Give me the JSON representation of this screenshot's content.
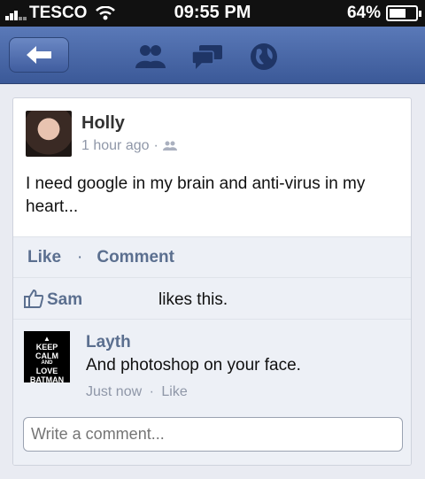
{
  "status_bar": {
    "carrier": "TESCO",
    "time": "09:55 PM",
    "battery": "64%",
    "battery_level": 0.64
  },
  "nav": {
    "back_icon": "back-arrow-icon",
    "icons": [
      "friends-icon",
      "messages-icon",
      "globe-icon"
    ]
  },
  "post": {
    "author": "Holly",
    "time": "1 hour ago",
    "separator": "·",
    "text": "I need google in my brain and anti-virus in my heart...",
    "actions": {
      "like": "Like",
      "separator": "·",
      "comment": "Comment"
    },
    "likes": {
      "name": "Sam",
      "text": "likes this."
    },
    "comment": {
      "avatar_text": [
        "KEEP",
        "CALM",
        "AND",
        "LOVE",
        "BATMAN"
      ],
      "author": "Layth",
      "text": "And photoshop on your face.",
      "time": "Just now",
      "separator": "·",
      "like": "Like"
    },
    "input": {
      "placeholder": "Write a comment..."
    }
  },
  "colors": {
    "nav_blue": "#3b5998",
    "link": "#5b6f8f",
    "muted": "#8f97a8"
  }
}
